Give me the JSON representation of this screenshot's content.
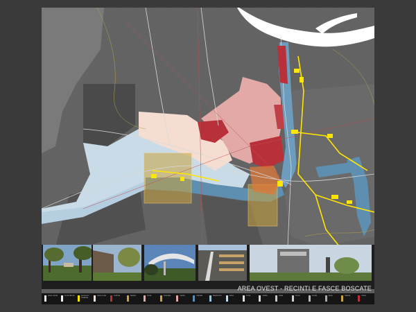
{
  "title": "AREA OVEST - RECINTI E FASCE BOSCATE",
  "colors": {
    "background": "#3a3a3a",
    "sheet": "#5e5e5e",
    "river": "#ffffff",
    "light_blue": "#c9dbe6",
    "steel_blue": "#5f8fb0",
    "rose": "#e8a6a4",
    "pale_rose": "#f6ddd2",
    "crimson": "#b8303a",
    "ochre": "#c9a240",
    "yellow_route": "#ffe600"
  },
  "photos": [
    {
      "name": "path-between-trees"
    },
    {
      "name": "industrial-wall"
    },
    {
      "name": "elevated-walkway"
    },
    {
      "name": "factory-building"
    },
    {
      "name": "industrial-tower"
    }
  ],
  "legend": [
    {
      "color": "#e9e9e9",
      "text": "area verde"
    },
    {
      "color": "#f3f3f3",
      "text": "zona libera"
    },
    {
      "color": "#ffe600",
      "text": "percorso ciclabile"
    },
    {
      "color": "#f6ddd2",
      "text": "area rosa"
    },
    {
      "color": "#b8303a",
      "text": "recinto"
    },
    {
      "color": "#c9a240",
      "text": "fascia"
    },
    {
      "color": "#e8a6a4",
      "text": "zona"
    },
    {
      "color": "#c9a240",
      "text": "boscata"
    },
    {
      "color": "#e8a6a4",
      "text": "verde"
    },
    {
      "color": "#5f8fb0",
      "text": "canale"
    },
    {
      "color": "#9ec1d8",
      "text": "fascia blu"
    },
    {
      "color": "#c9dbe6",
      "text": "area"
    },
    {
      "color": "#e0e0e0",
      "text": "zona"
    },
    {
      "color": "#d8d8d8",
      "text": "verde"
    },
    {
      "color": "#c8c8c8",
      "text": "area"
    },
    {
      "color": "#d0d0d0",
      "text": "zona"
    },
    {
      "color": "#bbbbbb",
      "text": "verde"
    },
    {
      "color": "#aaaaaa",
      "text": "area"
    },
    {
      "color": "#c9a240",
      "text": "fascia"
    },
    {
      "color": "#b8303a",
      "text": "zona"
    }
  ]
}
